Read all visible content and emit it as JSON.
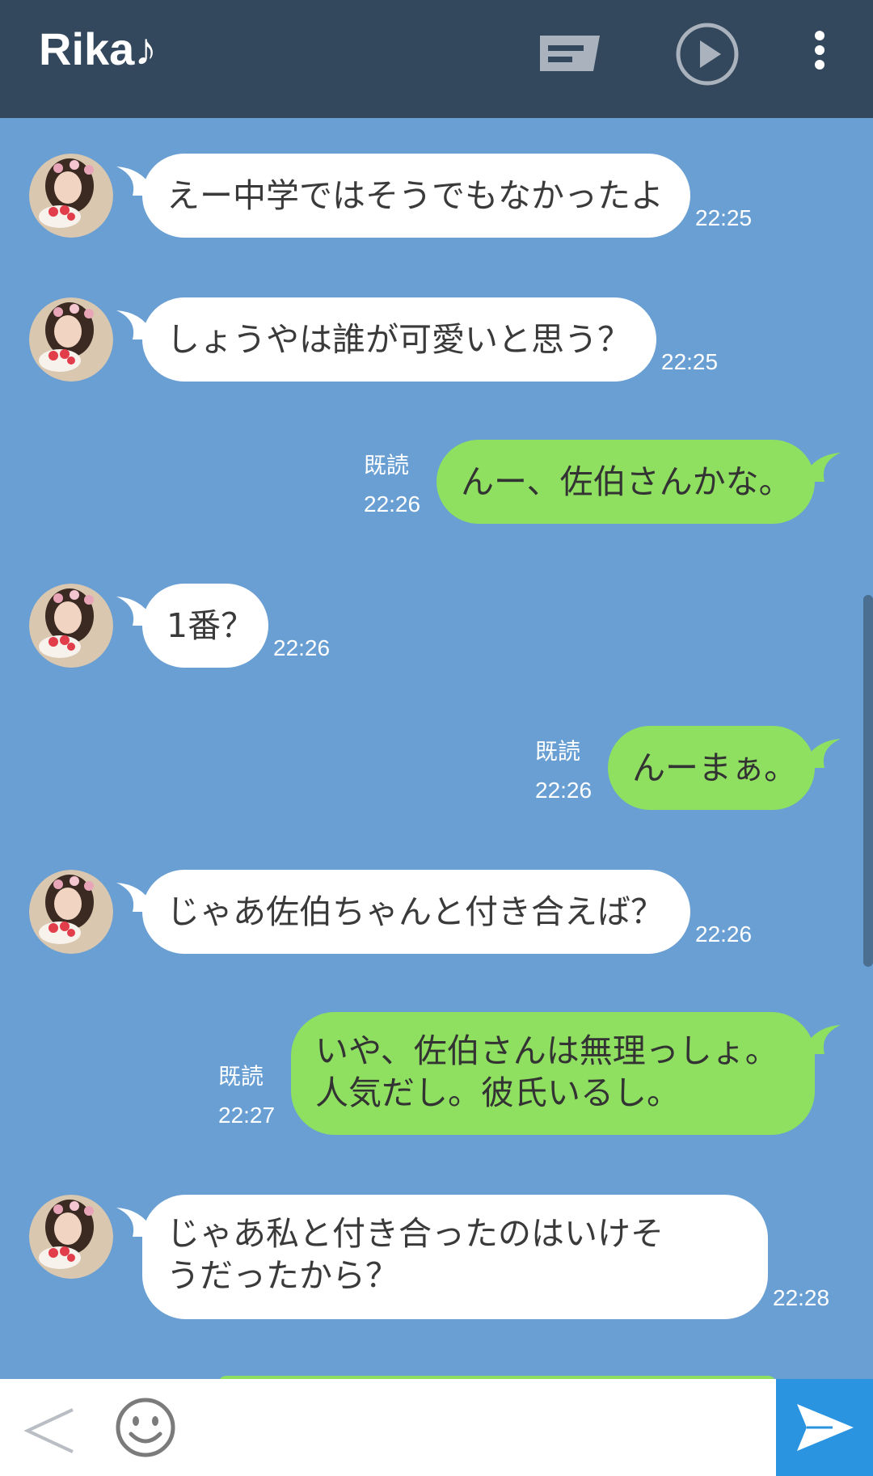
{
  "header": {
    "title": "Rika♪",
    "icons": [
      "note-icon",
      "play-icon",
      "more-vert-icon"
    ]
  },
  "messages": [
    {
      "side": "in",
      "text": "えー中学ではそうでもなかったよ",
      "time": "22:25"
    },
    {
      "side": "in",
      "text": "しょうやは誰が可愛いと思う？",
      "time": "22:25"
    },
    {
      "side": "out",
      "text": "んー、佐伯さんかな。",
      "read": "既読",
      "time": "22:26"
    },
    {
      "side": "in",
      "text": "1番？",
      "time": "22:26"
    },
    {
      "side": "out",
      "text": "んーまぁ。",
      "read": "既読",
      "time": "22:26"
    },
    {
      "side": "in",
      "text": "じゃあ佐伯ちゃんと付き合えば？",
      "time": "22:26"
    },
    {
      "side": "out",
      "text_lines": [
        "いや、佐伯さんは無理っしょ。",
        "人気だし。彼氏いるし。"
      ],
      "read": "既読",
      "time": "22:27"
    },
    {
      "side": "in",
      "text_lines": [
        "じゃあ私と付き合ったのはいけそ",
        "うだったから？"
      ],
      "time": "22:28"
    }
  ],
  "input_bar": {
    "icons": [
      "back-chevron-icon",
      "smiley-icon",
      "send-arrow-icon"
    ]
  },
  "colors": {
    "header_bg": "#33485c",
    "chat_bg": "#6a9fd3",
    "incoming_bubble": "#ffffff",
    "outgoing_bubble": "#8fdf60",
    "send_button": "#2a94e0"
  }
}
